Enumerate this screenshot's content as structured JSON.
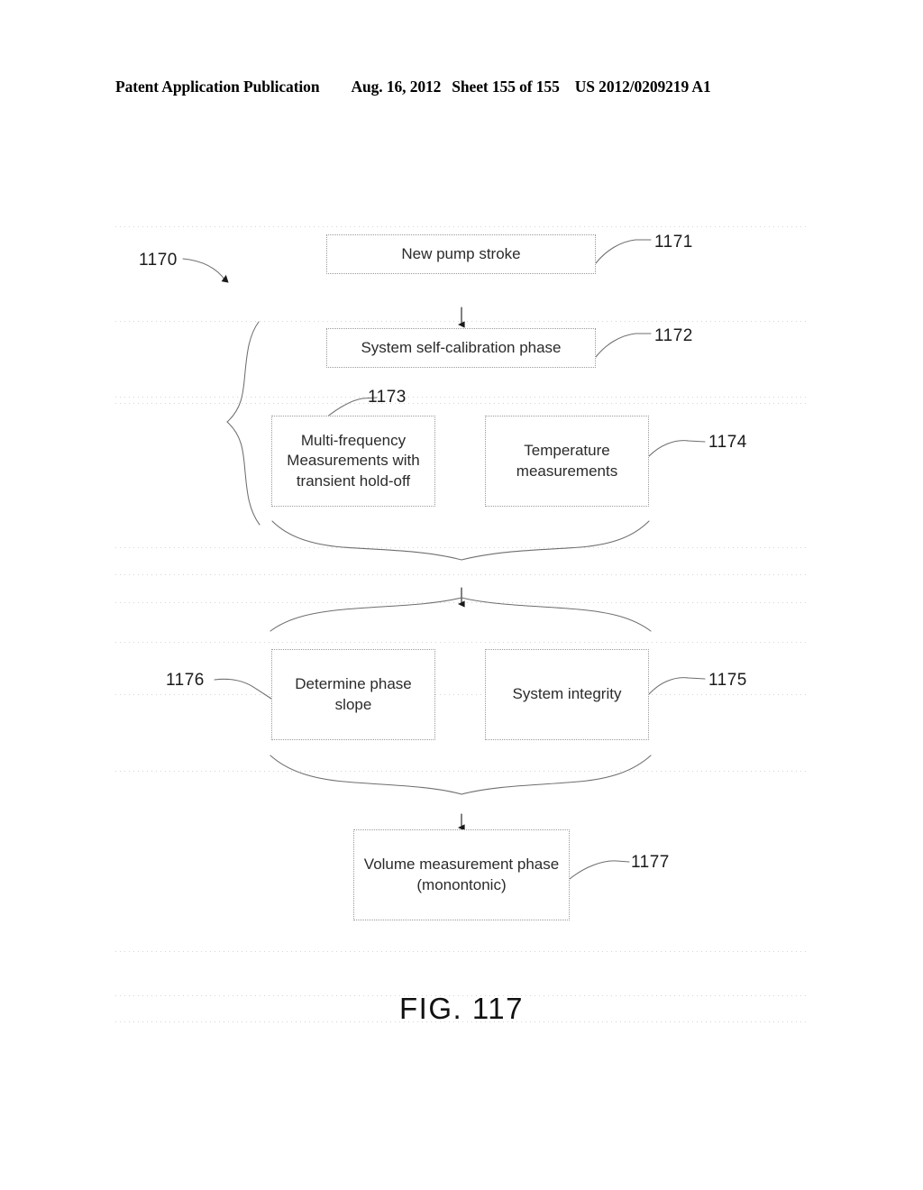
{
  "header": {
    "publication": "Patent Application Publication",
    "date": "Aug. 16, 2012",
    "sheet": "Sheet 155 of 155",
    "patent_number": "US 2012/0209219 A1"
  },
  "figure": {
    "caption": "FIG. 117",
    "diagram_reference": "1170"
  },
  "boxes": [
    {
      "ref": "1171",
      "label": "New pump stroke"
    },
    {
      "ref": "1172",
      "label": "System self-calibration phase"
    },
    {
      "ref": "1173",
      "label": "Multi-frequency Measurements with transient hold-off"
    },
    {
      "ref": "1174",
      "label": "Temperature measurements"
    },
    {
      "ref": "1176",
      "label": "Determine phase slope"
    },
    {
      "ref": "1175",
      "label": "System integrity"
    },
    {
      "ref": "1177",
      "label": "Volume measurement phase (monontonic)"
    }
  ],
  "refs": {
    "r1170": "1170",
    "r1171": "1171",
    "r1172": "1172",
    "r1173": "1173",
    "r1174": "1174",
    "r1175": "1175",
    "r1176": "1176",
    "r1177": "1177"
  },
  "colors": {
    "ink": "#1a1a1a",
    "box_border": "#9a9a9a",
    "scan_rule": "#96969f",
    "paper": "#ffffff"
  }
}
